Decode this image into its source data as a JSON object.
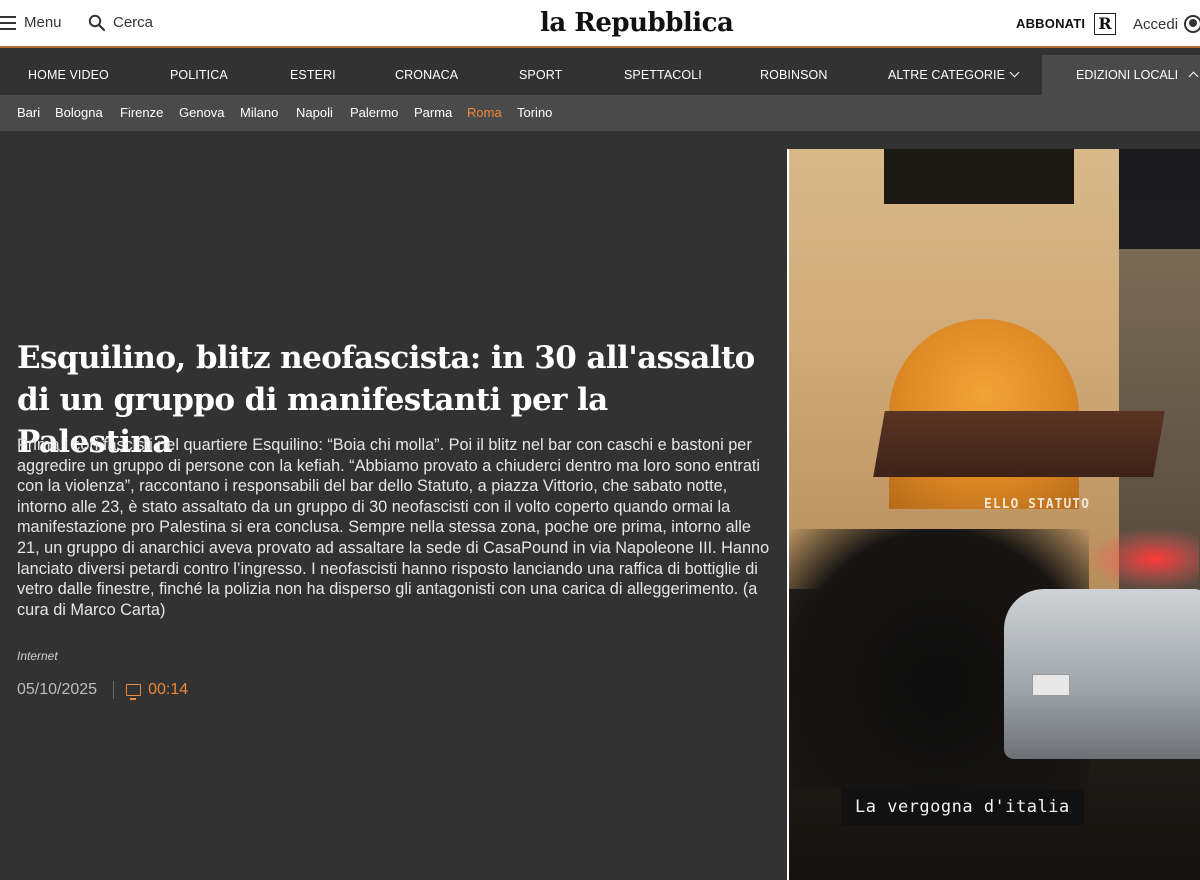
{
  "header": {
    "menu_label": "Menu",
    "search_label": "Cerca",
    "logo": "la Repubblica",
    "subscribe_label": "ABBONATI",
    "r_badge": "R",
    "login_label": "Accedi"
  },
  "mainnav": {
    "items": [
      "HOME VIDEO",
      "POLITICA",
      "ESTERI",
      "CRONACA",
      "SPORT",
      "SPETTACOLI",
      "ROBINSON",
      "ALTRE CATEGORIE"
    ],
    "edizioni_label": "EDIZIONI LOCALI"
  },
  "cities": {
    "items": [
      "Bari",
      "Bologna",
      "Firenze",
      "Genova",
      "Milano",
      "Napoli",
      "Palermo",
      "Parma",
      "Roma",
      "Torino"
    ],
    "active": "Roma"
  },
  "article": {
    "headline": "Esquilino, blitz neofascista: in 30 all'assalto di un gruppo di manifestanti per la Palestina",
    "summary": "Prima i cori fascisti nel quartiere Esquilino: “Boia chi molla”. Poi il blitz nel bar con caschi e bastoni per aggredire un gruppo di persone con la kefiah. “Abbiamo provato a chiuderci dentro ma loro sono entrati con la violenza”, raccontano i responsabili del bar dello Statuto, a piazza Vittorio, che sabato notte, intorno alle 23,  è stato assaltato da un gruppo di 30 neofascisti con il volto coperto quando ormai la manifestazione pro Palestina si era conclusa. Sempre nella stessa zona, poche ore prima, intorno alle 21, un gruppo di anarchici aveva provato ad assaltare la sede di CasaPound in via Napoleone III. Hanno lanciato diversi petardi contro l’ingresso. I neofascisti hanno risposto lanciando una raffica di bottiglie di vetro dalle finestre, finché la polizia non ha disperso gli antagonisti con una carica di alleggerimento. (a cura di Marco Carta)",
    "source": "Internet",
    "date": "05/10/2025",
    "duration": "00:14"
  },
  "video": {
    "sign_text": "ELLO STATUTO",
    "caption": "La vergogna d'italia"
  },
  "colors": {
    "accent": "#f0883a",
    "nav_bg": "#323232",
    "subnav_bg": "#4a4a4a",
    "header_border": "#b06b3a"
  }
}
